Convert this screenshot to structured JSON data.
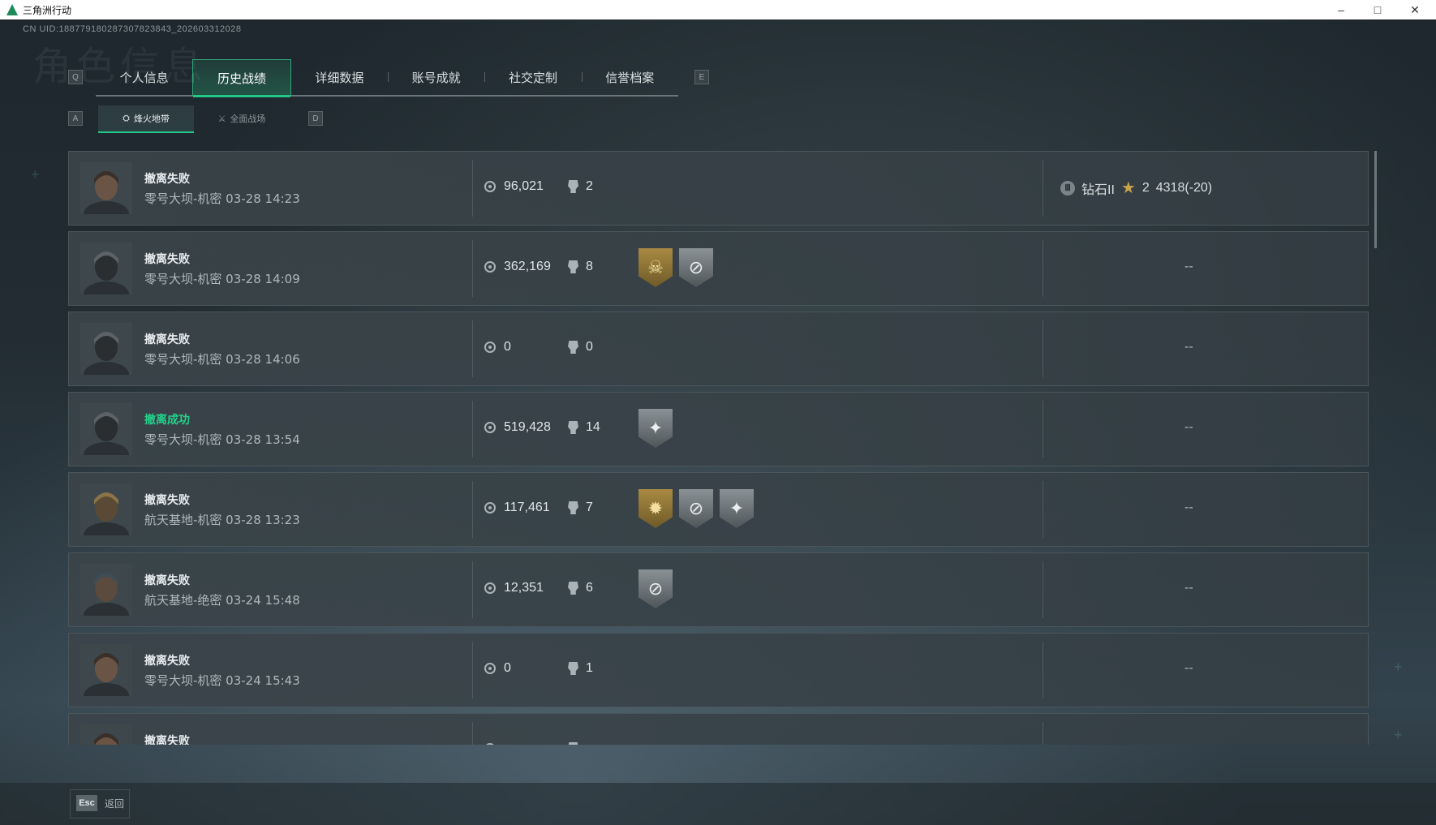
{
  "window": {
    "title": "三角洲行动",
    "min": "–",
    "max": "□",
    "close": "✕"
  },
  "uid": "CN UID:188779180287307823843_202603312028",
  "bg_title": "角色信息",
  "tabs": {
    "left_key": "Q",
    "right_key": "E",
    "items": [
      {
        "label": "个人信息"
      },
      {
        "label": "历史战绩",
        "active": true
      },
      {
        "label": "详细数据"
      },
      {
        "label": "账号成就"
      },
      {
        "label": "社交定制"
      },
      {
        "label": "信誉档案"
      }
    ]
  },
  "subtabs": {
    "left_key": "A",
    "right_key": "D",
    "items": [
      {
        "label": "烽火地带",
        "icon": "flame-zone-icon",
        "active": true
      },
      {
        "label": "全面战场",
        "icon": "battlefield-icon"
      }
    ]
  },
  "records": [
    {
      "result": "撤离失败",
      "success": false,
      "meta": "零号大坝-机密 03-28 14:23",
      "coins": "96,021",
      "kills": "2",
      "badges": [],
      "rank": {
        "tier": "钻石II",
        "stars": "2",
        "score": "4318(-20)"
      },
      "avatar": "dark-hair"
    },
    {
      "result": "撤离失败",
      "success": false,
      "meta": "零号大坝-机密 03-28 14:09",
      "coins": "362,169",
      "kills": "8",
      "badges": [
        "gold-skull-badge",
        "silver-crosshair-badge"
      ],
      "empty": "--",
      "avatar": "masked"
    },
    {
      "result": "撤离失败",
      "success": false,
      "meta": "零号大坝-机密 03-28 14:06",
      "coins": "0",
      "kills": "0",
      "badges": [],
      "empty": "--",
      "avatar": "masked"
    },
    {
      "result": "撤离成功",
      "success": true,
      "meta": "零号大坝-机密 03-28 13:54",
      "coins": "519,428",
      "kills": "14",
      "badges": [
        "silver-star-badge"
      ],
      "empty": "--",
      "avatar": "masked"
    },
    {
      "result": "撤离失败",
      "success": false,
      "meta": "航天基地-机密 03-28 13:23",
      "coins": "117,461",
      "kills": "7",
      "badges": [
        "gold-sun-badge",
        "silver-crosshair-badge",
        "silver-star-badge"
      ],
      "empty": "--",
      "avatar": "blond"
    },
    {
      "result": "撤离失败",
      "success": false,
      "meta": "航天基地-绝密 03-24 15:48",
      "coins": "12,351",
      "kills": "6",
      "badges": [
        "silver-crosshair-badge"
      ],
      "empty": "--",
      "avatar": "cap"
    },
    {
      "result": "撤离失败",
      "success": false,
      "meta": "零号大坝-机密 03-24 15:43",
      "coins": "0",
      "kills": "1",
      "badges": [],
      "empty": "--",
      "avatar": "dark-hair"
    },
    {
      "result": "撤离失败",
      "success": false,
      "meta": "",
      "coins": "",
      "kills": "",
      "badges": [],
      "empty": "",
      "avatar": "dark-hair"
    }
  ],
  "colors": {
    "accent": "#22c786",
    "success": "#23d38b",
    "gold": "#a88a42"
  },
  "footer": {
    "esc_key": "Esc",
    "label": "返回"
  }
}
